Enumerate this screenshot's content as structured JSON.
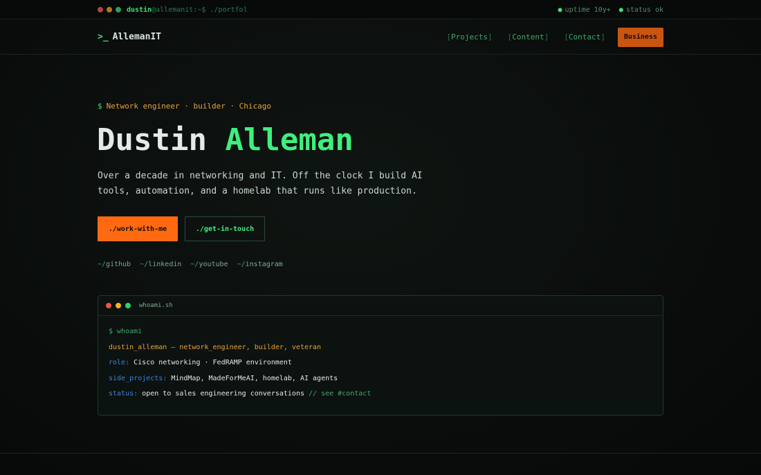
{
  "statusbar": {
    "user": "dustin",
    "host_path": "@allemanit:~$ ./portfol",
    "uptime": "uptime 10y+",
    "status": "status ok"
  },
  "nav": {
    "logo_prompt": ">_",
    "logo_text": "AllemanIT",
    "links": [
      {
        "label": "Projects"
      },
      {
        "label": "Content"
      },
      {
        "label": "Contact"
      }
    ],
    "business_label": "Business"
  },
  "hero": {
    "tagline_prompt": "$",
    "tagline": "Network engineer · builder · Chicago",
    "first_name": "Dustin",
    "last_name": "Alleman",
    "intro": "Over a decade in networking and IT. Off the clock I build AI tools, automation, and a homelab that runs like production.",
    "primary_button": "./work-with-me",
    "secondary_button": "./get-in-touch",
    "social": [
      {
        "prefix": "~/",
        "label": "github"
      },
      {
        "prefix": "~/",
        "label": "linkedin"
      },
      {
        "prefix": "~/",
        "label": "youtube"
      },
      {
        "prefix": "~/",
        "label": "instagram"
      }
    ]
  },
  "terminal": {
    "title": "whoami.sh",
    "command": "$ whoami",
    "identity": "dustin_alleman — network_engineer, builder, veteran",
    "role_key": "role:",
    "role_value": "Cisco networking · FedRAMP environment",
    "projects_key": "side_projects:",
    "projects_value": "MindMap, MadeForMeAI, homelab, AI agents",
    "status_key": "status:",
    "status_value": "open to sales engineering conversations",
    "status_comment": "// see #contact"
  },
  "colors": {
    "accent_green": "#3ef07e",
    "accent_orange": "#ff6a10",
    "background": "#0a0d0c"
  }
}
